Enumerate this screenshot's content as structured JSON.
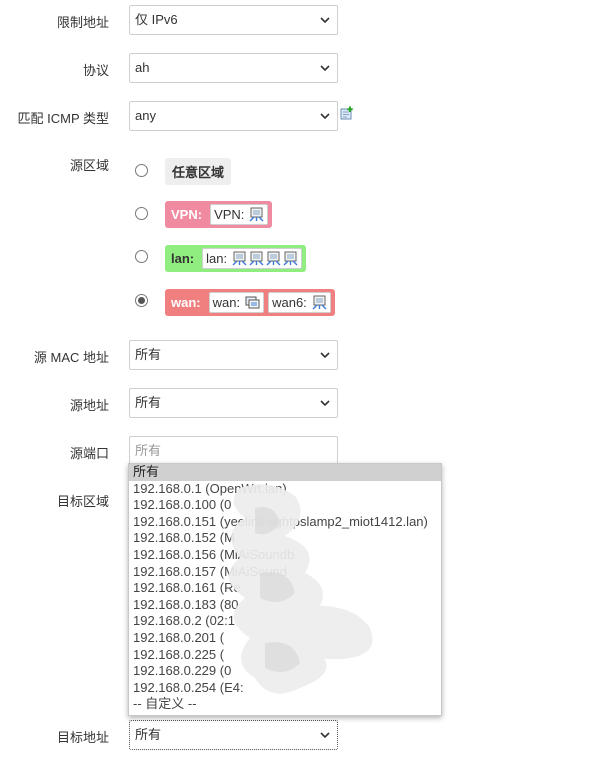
{
  "form": {
    "restrict_address": {
      "label": "限制地址",
      "value": "仅 IPv6"
    },
    "protocol": {
      "label": "协议",
      "value": "ah"
    },
    "icmp_type": {
      "label": "匹配 ICMP 类型",
      "value": "any"
    },
    "source_zone": {
      "label": "源区域",
      "options": [
        {
          "zone": "任意区域",
          "interfaces": [],
          "selected": false
        },
        {
          "zone": "VPN:",
          "interfaces": [
            {
              "label": "VPN:",
              "icons": [
                "network-interface-icon"
              ]
            }
          ],
          "selected": false
        },
        {
          "zone": "lan:",
          "interfaces": [
            {
              "label": "lan:",
              "icons": [
                "network-interface-icon",
                "network-interface-icon",
                "network-interface-icon",
                "network-interface-icon"
              ]
            }
          ],
          "selected": false
        },
        {
          "zone": "wan:",
          "interfaces": [
            {
              "label": "wan:",
              "icons": [
                "network-switch-icon"
              ]
            },
            {
              "label": "wan6:",
              "icons": [
                "network-interface-icon"
              ]
            }
          ],
          "selected": true
        }
      ]
    },
    "source_mac": {
      "label": "源 MAC 地址",
      "value": "所有"
    },
    "source_address": {
      "label": "源地址",
      "value": "所有"
    },
    "source_port": {
      "label": "源端口",
      "placeholder": "所有"
    },
    "destination_zone": {
      "label": "目标区域"
    },
    "destination_address": {
      "label": "目标地址",
      "value": "所有"
    }
  },
  "dropdown": {
    "options": [
      "所有",
      "192.168.0.1 (OpenWrt.lan)",
      "192.168.0.100 (0",
      "192.168.0.151 (yeelink-lightpslamp2_miot1412.lan)",
      "192.168.0.152 (M",
      "192.168.0.156 (MiAiSoundb",
      "192.168.0.157 (MiAiSound",
      "192.168.0.161 (Re",
      "192.168.0.183 (80",
      "192.168.0.2 (02:1",
      "192.168.0.201 (",
      "192.168.0.225 (",
      "192.168.0.229 (0",
      "192.168.0.254 (E4:",
      "-- 自定义 --"
    ],
    "selected_index": 0
  },
  "colors": {
    "zone_vpn": "#f08aa0",
    "zone_lan": "#90ee80",
    "zone_wan": "#f08080",
    "zone_any": "#eeeeee"
  }
}
